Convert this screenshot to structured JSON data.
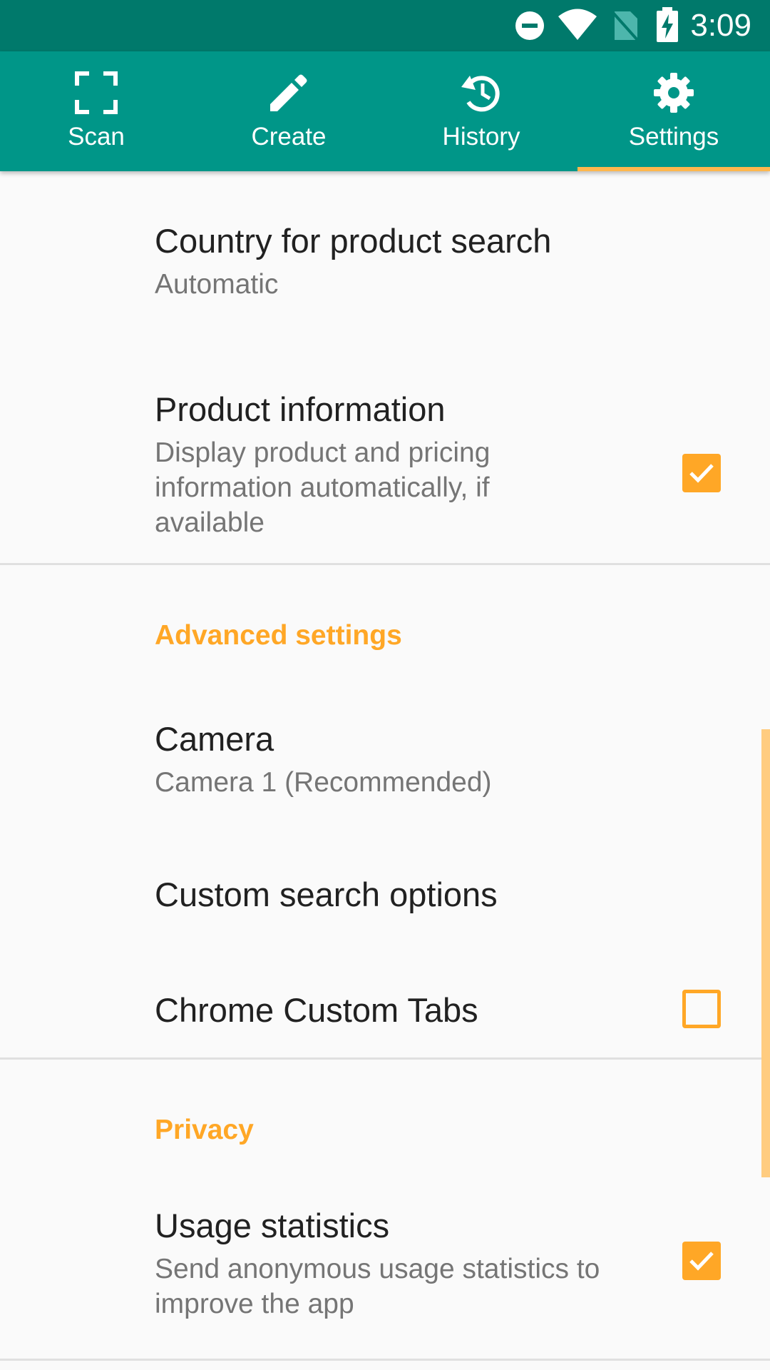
{
  "status_bar": {
    "time": "3:09",
    "icons": [
      "do-not-disturb-icon",
      "wifi-icon",
      "no-sim-icon",
      "battery-charging-icon"
    ]
  },
  "tabs": [
    {
      "label": "Scan",
      "icon": "scan-icon",
      "selected": false
    },
    {
      "label": "Create",
      "icon": "pencil-icon",
      "selected": false
    },
    {
      "label": "History",
      "icon": "history-icon",
      "selected": false
    },
    {
      "label": "Settings",
      "icon": "gear-icon",
      "selected": true
    }
  ],
  "settings": {
    "country": {
      "title": "Country for product search",
      "summary": "Automatic"
    },
    "product_info": {
      "title": "Product information",
      "summary": "Display product and pricing information automatically, if available",
      "checked": true
    },
    "advanced_header": "Advanced settings",
    "camera": {
      "title": "Camera",
      "summary": "Camera 1 (Recommended)"
    },
    "custom_search": {
      "title": "Custom search options"
    },
    "chrome_tabs": {
      "title": "Chrome Custom Tabs",
      "checked": false
    },
    "privacy_header": "Privacy",
    "usage_stats": {
      "title": "Usage statistics",
      "summary": "Send anonymous usage statistics to improve the app",
      "checked": true
    }
  },
  "colors": {
    "status_bar": "#00796B",
    "app_bar": "#009688",
    "accent": "#FFA726",
    "background": "#FAFAFA"
  }
}
